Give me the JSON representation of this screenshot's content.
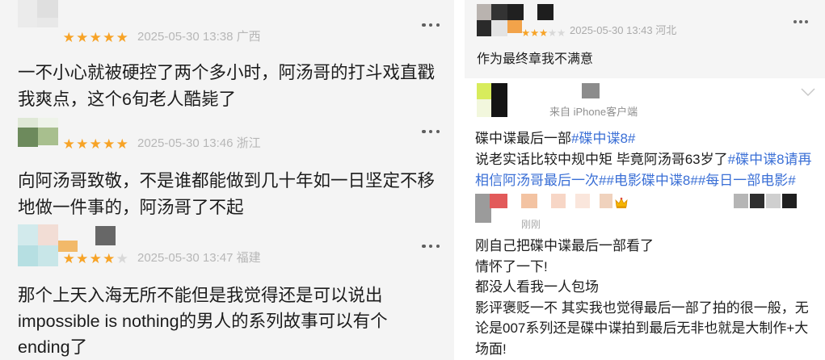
{
  "colors": {
    "star_filled": "#f7a326",
    "star_empty": "#d8d8d8",
    "hashtag": "#3a6fd6",
    "meta": "#b7b7b7",
    "text": "#1c1c1c"
  },
  "icons": {
    "more": "more-options-icon",
    "star": "star-icon",
    "chevron": "chevron-down-icon",
    "crown": "crown-icon"
  },
  "reviews": [
    {
      "rating": 5,
      "date": "2025-05-30 13:38",
      "location": "广西",
      "lines": [
        "一不小心就被硬控了两个多小时，阿汤哥的打斗戏直戳",
        "我爽点，这个6旬老人酷毙了"
      ]
    },
    {
      "rating": 5,
      "date": "2025-05-30 13:46",
      "location": "浙江",
      "lines": [
        "向阿汤哥致敬，不是谁都能做到几十年如一日坚定不移",
        "地做一件事的，阿汤哥了不起"
      ]
    },
    {
      "rating": 4,
      "date": "2025-05-30 13:47",
      "location": "福建",
      "lines": [
        "那个上天入海无所不能但是我觉得还是可以说出",
        "impossible is nothing的男人的系列故事可以有个",
        "ending了"
      ]
    }
  ],
  "review_right": {
    "rating": 3,
    "date": "2025-05-30 13:43",
    "location": "河北",
    "text": "作为最终章我不满意"
  },
  "post": {
    "source": "来自 iPhone客户端",
    "header_lines": [
      {
        "text": "碟中谍最后一部",
        "hashtag": "#碟中谍8#"
      },
      {
        "text": "说老实话比较中规中矩 毕竟阿汤哥63岁了",
        "hashtag": "#碟中谍8请再"
      },
      {
        "hashtag": "相信阿汤哥最后一次##电影碟中谍8##每日一部电影#"
      }
    ],
    "time": "刚刚",
    "body_lines": [
      "刚自己把碟中谍最后一部看了",
      "情怀了一下!",
      "都没人看我一人包场",
      "影评褒贬一不 其实我也觉得最后一部了拍的很一般，无",
      "论是007系列还是碟中谍拍到最后无非也就是大制作+大",
      "场面!"
    ]
  }
}
